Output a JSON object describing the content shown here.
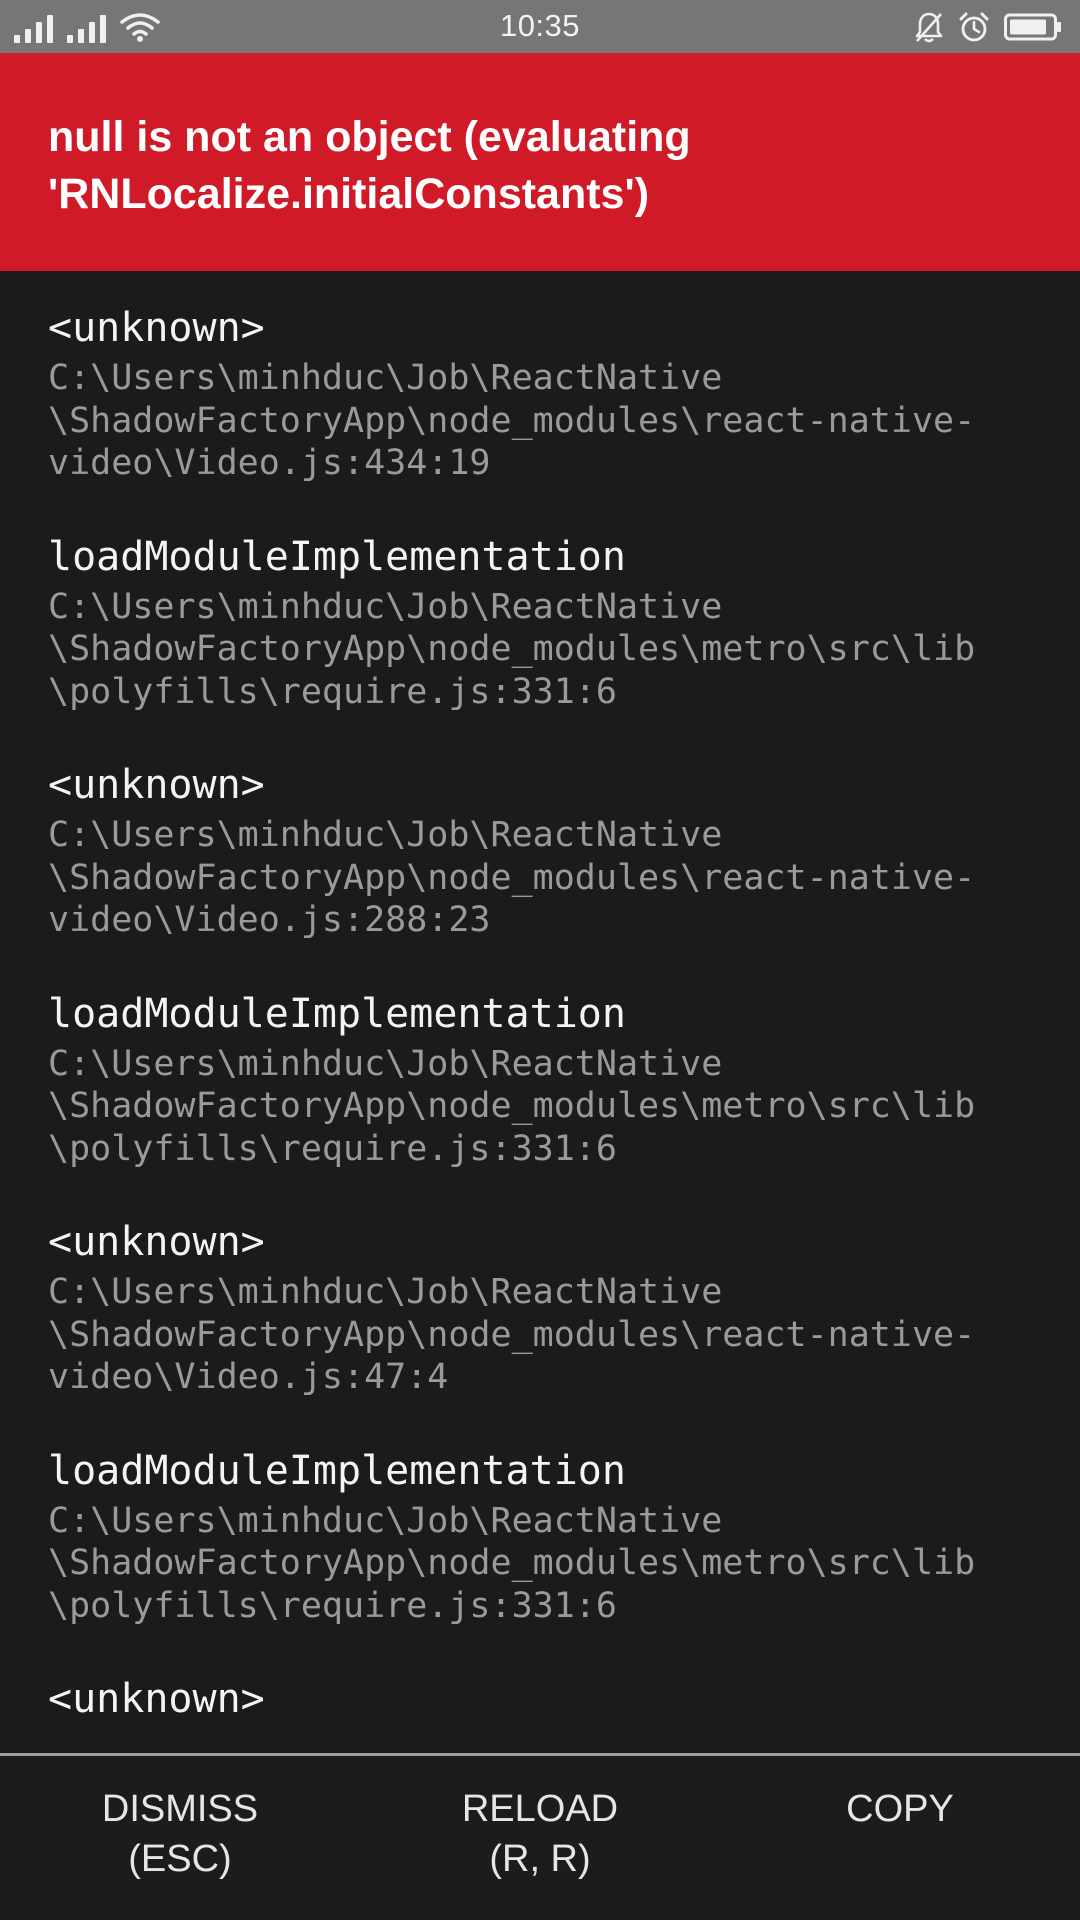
{
  "status_bar": {
    "time": "10:35",
    "icons": [
      "signal-icon",
      "signal-icon",
      "wifi-icon",
      "notifications-off-icon",
      "alarm-icon",
      "battery-icon"
    ]
  },
  "error": {
    "message": "null is not an object (evaluating 'RNLocalize.initialConstants')"
  },
  "stack": {
    "frames": [
      {
        "method": "<unknown>",
        "file_lines": [
          "C:\\Users\\minhduc\\Job\\ReactNative",
          "\\ShadowFactoryApp\\node_modules\\react-native-",
          "video\\Video.js:434:19"
        ]
      },
      {
        "method": "loadModuleImplementation",
        "file_lines": [
          "C:\\Users\\minhduc\\Job\\ReactNative",
          "\\ShadowFactoryApp\\node_modules\\metro\\src\\lib",
          "\\polyfills\\require.js:331:6"
        ]
      },
      {
        "method": "<unknown>",
        "file_lines": [
          "C:\\Users\\minhduc\\Job\\ReactNative",
          "\\ShadowFactoryApp\\node_modules\\react-native-",
          "video\\Video.js:288:23"
        ]
      },
      {
        "method": "loadModuleImplementation",
        "file_lines": [
          "C:\\Users\\minhduc\\Job\\ReactNative",
          "\\ShadowFactoryApp\\node_modules\\metro\\src\\lib",
          "\\polyfills\\require.js:331:6"
        ]
      },
      {
        "method": "<unknown>",
        "file_lines": [
          "C:\\Users\\minhduc\\Job\\ReactNative",
          "\\ShadowFactoryApp\\node_modules\\react-native-",
          "video\\Video.js:47:4"
        ]
      },
      {
        "method": "loadModuleImplementation",
        "file_lines": [
          "C:\\Users\\minhduc\\Job\\ReactNative",
          "\\ShadowFactoryApp\\node_modules\\metro\\src\\lib",
          "\\polyfills\\require.js:331:6"
        ]
      },
      {
        "method": "<unknown>",
        "file_lines": []
      }
    ]
  },
  "toolbar": {
    "dismiss": {
      "line1": "DISMISS",
      "line2": "(ESC)"
    },
    "reload": {
      "line1": "RELOAD",
      "line2": "(R, R)"
    },
    "copy": {
      "line1": "COPY",
      "line2": ""
    }
  },
  "colors": {
    "status_bar_bg": "#767676",
    "error_header_bg": "#d01a28",
    "stack_bg": "#1b1b1c",
    "method_text": "#f4f4f4",
    "file_text": "#9a9a9a",
    "toolbar_divider": "#9d9d9d"
  }
}
